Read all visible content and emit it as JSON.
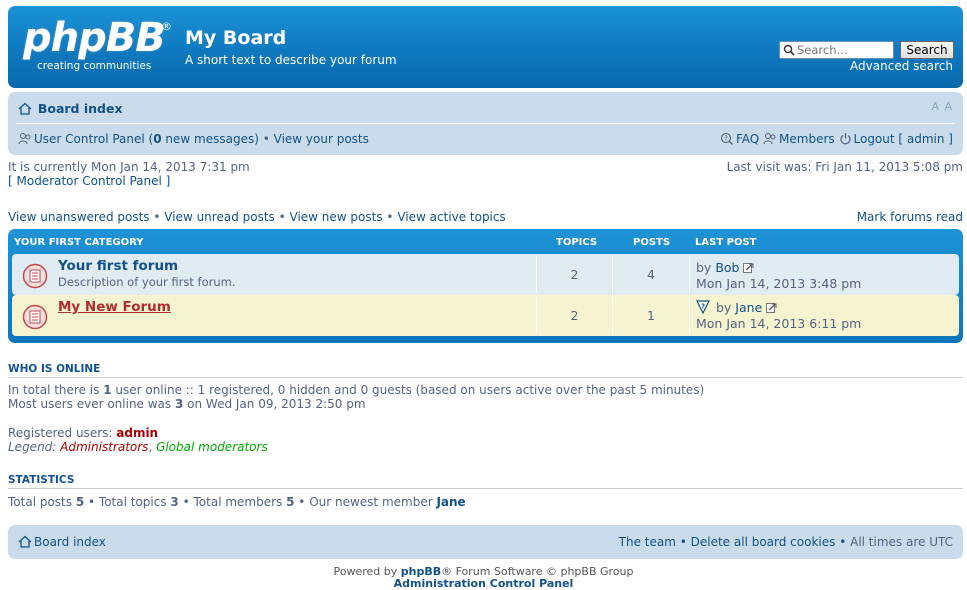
{
  "header": {
    "logo_word": "phpBB",
    "logo_reg": "®",
    "logo_tagline": "creating   communities",
    "site_title": "My Board",
    "site_desc": "A short text to describe your forum",
    "search_placeholder": "Search…",
    "search_button": "Search",
    "advanced_search": "Advanced search"
  },
  "navbar": {
    "board_index": "Board index",
    "font_resize": "A A",
    "ucp": "User Control Panel (",
    "new_msgs_count": "0",
    "new_msgs_suffix": " new messages)",
    "view_posts": "View your posts",
    "faq": "FAQ",
    "members": "Members",
    "logout": "Logout [ admin ]"
  },
  "info": {
    "current_time": "It is currently Mon Jan 14, 2013 7:31 pm",
    "mcp": "[ Moderator Control Panel ]",
    "last_visit": "Last visit was: Fri Jan 11, 2013 5:08 pm",
    "quick_links": [
      "View unanswered posts",
      "View unread posts",
      "View new posts",
      "View active topics"
    ],
    "mark_read": "Mark forums read"
  },
  "forumlist": {
    "category": "Your first category",
    "col_topics": "Topics",
    "col_posts": "Posts",
    "col_last": "Last post",
    "forums": [
      {
        "name": "Your first forum",
        "desc": "Description of your first forum.",
        "topics": "2",
        "posts": "4",
        "last_by": "by ",
        "last_author": "Bob",
        "last_date": "Mon Jan 14, 2013 3:48 pm"
      },
      {
        "name": "My New Forum",
        "desc": "",
        "topics": "2",
        "posts": "1",
        "last_by": "by ",
        "last_author": "Jane",
        "last_date": "Mon Jan 14, 2013 6:11 pm"
      }
    ]
  },
  "online": {
    "title": "Who is online",
    "line1_a": "In total there is ",
    "line1_count": "1",
    "line1_b": " user online :: 1 registered, 0 hidden and 0 guests (based on users active over the past 5 minutes)",
    "line2_a": "Most users ever online was ",
    "line2_count": "3",
    "line2_b": " on Wed Jan 09, 2013 2:50 pm",
    "registered_label": "Registered users: ",
    "registered_user": "admin",
    "legend_label": "Legend",
    "legend_admin": "Administrators",
    "legend_global": "Global moderators"
  },
  "stats": {
    "title": "Statistics",
    "posts_label": "Total posts ",
    "posts": "5",
    "topics_label": "Total topics ",
    "topics": "3",
    "members_label": "Total members ",
    "members": "5",
    "newest_label": "Our newest member ",
    "newest": "Jane"
  },
  "footer": {
    "board_index": "Board index",
    "team": "The team",
    "delete_cookies": "Delete all board cookies",
    "timezone": "All times are UTC",
    "powered_a": "Powered by ",
    "powered_brand": "phpBB",
    "powered_b": "® Forum Software © phpBB Group",
    "acp": "Administration Control Panel"
  },
  "colors": {
    "header_blue": "#0f79c0",
    "nav_bg": "#cadceb",
    "link": "#105289",
    "admin_red": "#aa0000",
    "global_green": "#00aa00",
    "row_alt": "#f6f4d0"
  }
}
